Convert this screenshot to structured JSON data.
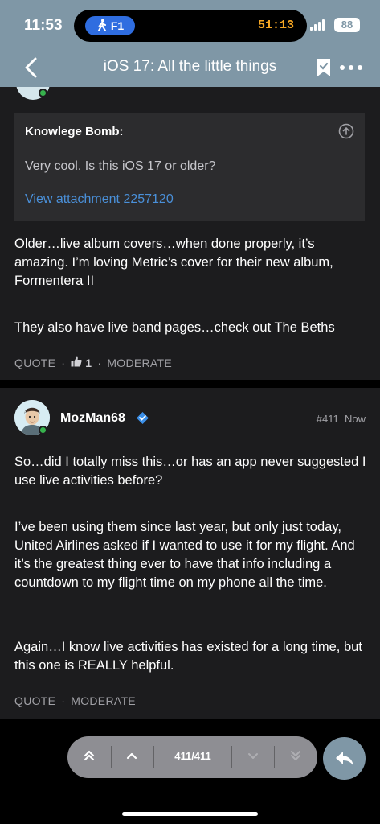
{
  "status_bar": {
    "time": "11:53",
    "live_activity_label": "F1",
    "live_activity_timer": "51:13",
    "battery": "88"
  },
  "header": {
    "title": "iOS 17: All the little things"
  },
  "post1": {
    "quote": {
      "author": "Knowlege Bomb:",
      "text": "Very cool. Is this iOS 17 or older?",
      "attachment_link": "View attachment 2257120"
    },
    "paragraphs": [
      "Older…live album covers…when done properly, it’s amazing. I’m loving Metric’s cover for their new album, Formentera II",
      "They also have live band pages…check out The Beths"
    ],
    "actions": {
      "quote": "QUOTE",
      "like_count": "1",
      "moderate": "MODERATE"
    }
  },
  "post2": {
    "username": "MozMan68",
    "post_number": "#411",
    "time": "Now",
    "paragraphs": [
      "So…did I totally miss this…or has an app never suggested I use live activities before?",
      "I’ve been using them since last year, but only just today, United Airlines asked if I wanted to use it for my flight. And it’s the greatest thing ever to have that info including a countdown to my flight time on my phone all the time.",
      "Again…I know live activities has existed for a long time, but this one is REALLY helpful."
    ],
    "actions": {
      "quote": "QUOTE",
      "moderate": "MODERATE"
    }
  },
  "navigation": {
    "page_count": "411/411"
  },
  "colors": {
    "header_bg": "#7f97a6",
    "post_bg": "#1c1c1e",
    "link": "#4a90d9",
    "online": "#37b24d",
    "verified": "#3b8fe8"
  }
}
